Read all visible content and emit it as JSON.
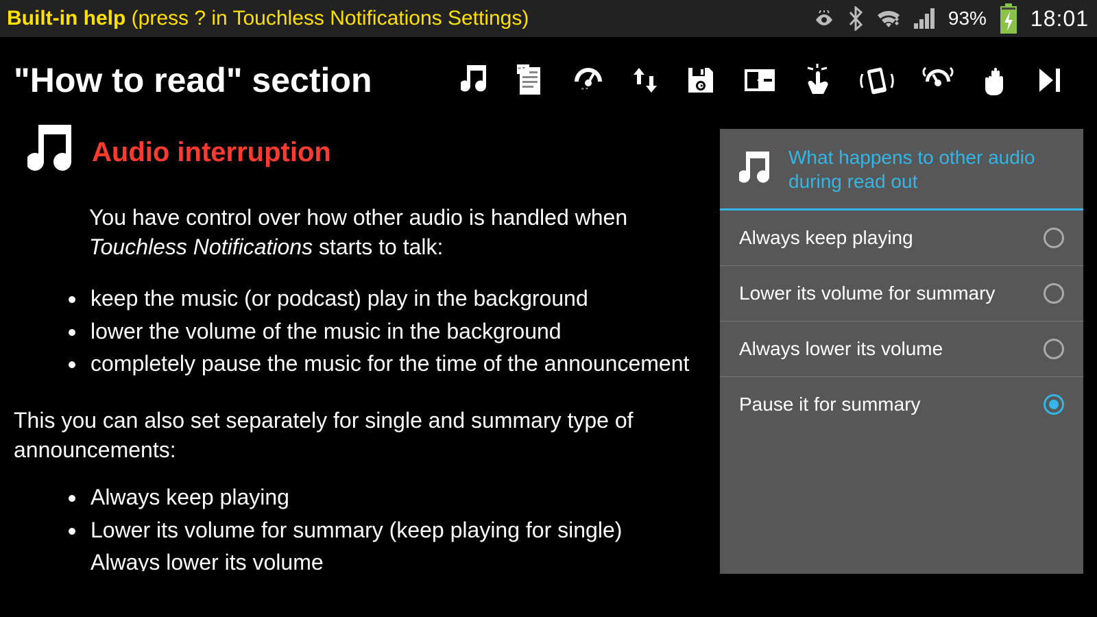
{
  "status": {
    "help_bold": "Built-in help",
    "help_rest": " (press ? in Touchless Notifications Settings)",
    "battery_pct": "93%",
    "time": "18:01"
  },
  "header": {
    "title": "\"How to read\" section"
  },
  "nav_icons": [
    "music",
    "notes",
    "gauge",
    "updown",
    "save",
    "layout",
    "touch",
    "shake",
    "sensor",
    "hand",
    "next"
  ],
  "section": {
    "title": "Audio interruption",
    "intro_pre": "You have control over how other audio is handled when ",
    "intro_em": "Touchless Notifications",
    "intro_post": " starts to talk:",
    "bullets": [
      "keep the music (or podcast) play in the background",
      "lower the volume of the music in the background",
      "completely pause the music for the time of the announcement"
    ],
    "sep": "This you can also set separately for single and summary type of announcements:",
    "bullets2": [
      "Always keep playing",
      "Lower its volume for summary (keep playing for single)",
      "Always lower its volume"
    ]
  },
  "panel": {
    "heading": "What happens to other audio during read out",
    "options": [
      {
        "label": "Always keep playing",
        "selected": false
      },
      {
        "label": "Lower its volume for summary",
        "selected": false
      },
      {
        "label": "Always lower its volume",
        "selected": false
      },
      {
        "label": "Pause it for summary",
        "selected": true
      }
    ]
  }
}
